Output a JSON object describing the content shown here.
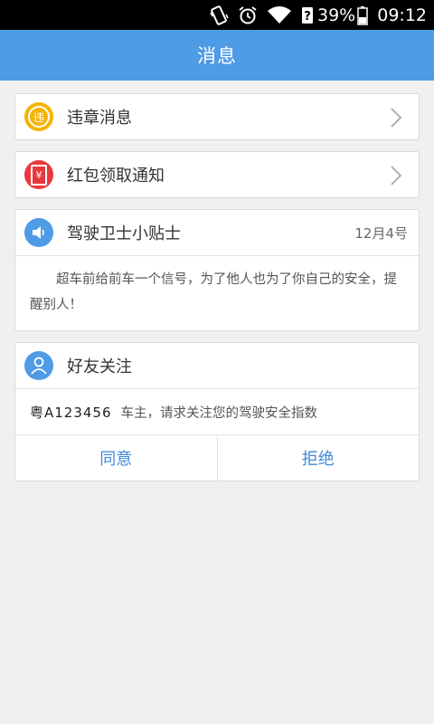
{
  "status_bar": {
    "battery": "39%",
    "time": "09:12"
  },
  "header": {
    "title": "消息"
  },
  "items": [
    {
      "label": "违章消息",
      "icon_char": "违",
      "icon_color": "#f5b400"
    },
    {
      "label": "红包领取通知",
      "icon_char": "¥",
      "icon_color": "#e8383d"
    }
  ],
  "tip": {
    "title": "驾驶卫士小贴士",
    "date": "12月4号",
    "text": "超车前给前车一个信号，为了他人也为了你自己的安全，提醒别人！",
    "icon_color": "#4e9be6"
  },
  "friend": {
    "title": "好友关注",
    "plate": "粤A123456",
    "message": "车主，请求关注您的驾驶安全指数",
    "accept_label": "同意",
    "reject_label": "拒绝",
    "icon_color": "#4e9be6"
  }
}
